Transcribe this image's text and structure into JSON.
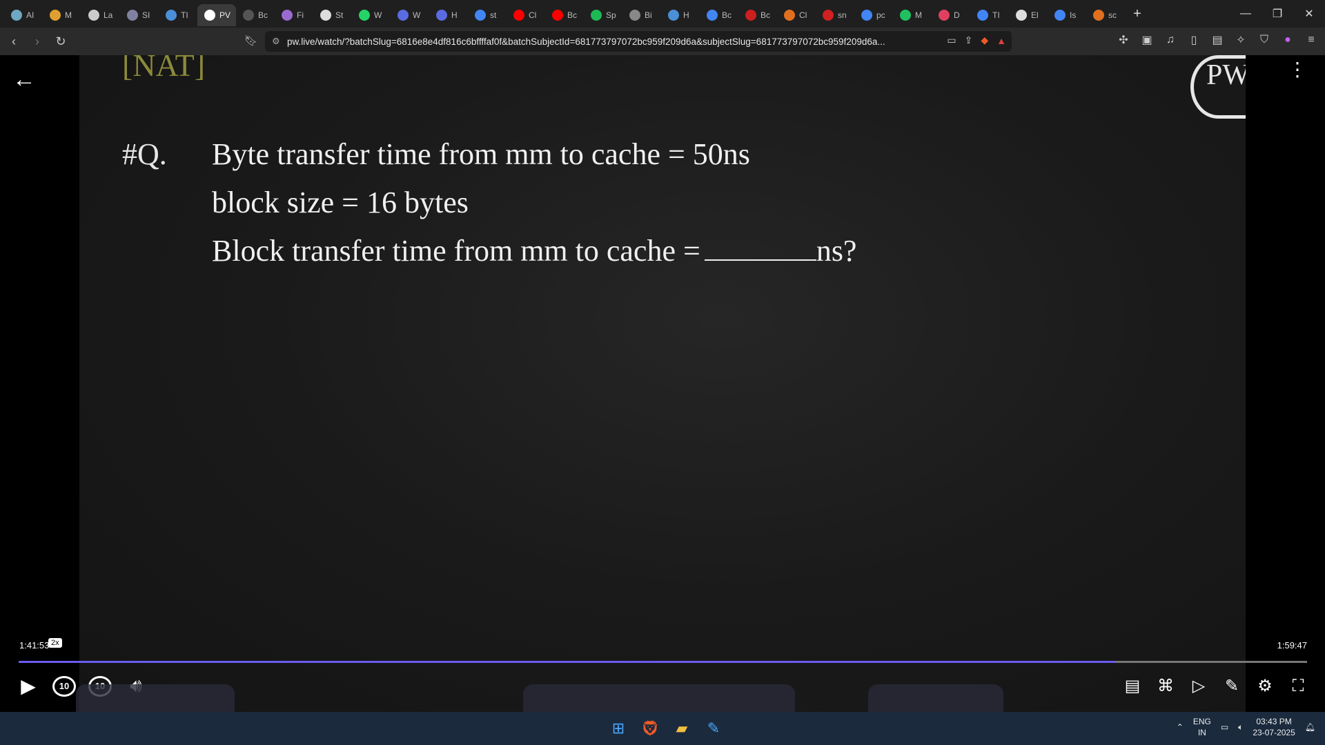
{
  "browser": {
    "tabs": [
      {
        "label": "AI",
        "color": "#6fa8c4"
      },
      {
        "label": "M",
        "color": "#e0a030"
      },
      {
        "label": "La",
        "color": "#cccccc"
      },
      {
        "label": "SI",
        "color": "#8080a0"
      },
      {
        "label": "TI",
        "color": "#4a8fd8"
      },
      {
        "label": "PV",
        "color": "#ffffff",
        "active": true
      },
      {
        "label": "Bc",
        "color": "#555555"
      },
      {
        "label": "Fi",
        "color": "#9a6ad0"
      },
      {
        "label": "St",
        "color": "#dddddd"
      },
      {
        "label": "W",
        "color": "#25d366"
      },
      {
        "label": "W",
        "color": "#5a6ae0"
      },
      {
        "label": "H",
        "color": "#5a6ae0"
      },
      {
        "label": "st",
        "color": "#4285f4"
      },
      {
        "label": "Cl",
        "color": "#ff0000"
      },
      {
        "label": "Bc",
        "color": "#ff0000"
      },
      {
        "label": "Sp",
        "color": "#1db954"
      },
      {
        "label": "Bi",
        "color": "#888888"
      },
      {
        "label": "H",
        "color": "#4a8fd8"
      },
      {
        "label": "Bc",
        "color": "#4285f4"
      },
      {
        "label": "Bc",
        "color": "#cc2020"
      },
      {
        "label": "Cl",
        "color": "#e07020"
      },
      {
        "label": "sn",
        "color": "#d02020"
      },
      {
        "label": "pc",
        "color": "#4285f4"
      },
      {
        "label": "M",
        "color": "#20c060"
      },
      {
        "label": "D",
        "color": "#e04060"
      },
      {
        "label": "TI",
        "color": "#4285f4"
      },
      {
        "label": "El",
        "color": "#dddddd"
      },
      {
        "label": "Is",
        "color": "#4285f4"
      },
      {
        "label": "sc",
        "color": "#e07020"
      }
    ],
    "active_tab_close": "✕",
    "new_tab": "+",
    "window_controls": {
      "minimize": "—",
      "restore": "❐",
      "close": "✕"
    },
    "url": "pw.live/watch/?batchSlug=6816e8e4df816c6bffffaf0f&batchSubjectId=681773797072bc959f209d6a&subjectSlug=681773797072bc959f209d6a..."
  },
  "video": {
    "tag": "[NAT]",
    "question_label": "#Q.",
    "lines": [
      "Byte transfer time from mm to cache = 50ns",
      "block size = 16 bytes",
      "Block transfer time from mm to cache ="
    ],
    "blank_suffix": "ns?",
    "logo": "PW"
  },
  "player": {
    "current_time": "1:41:53",
    "speed": "2x",
    "duration": "1:59:47",
    "progress_fraction": 0.851,
    "skip_back": "10",
    "skip_forward": "10"
  },
  "taskbar": {
    "lang_top": "ENG",
    "lang_bottom": "IN",
    "time": "03:43 PM",
    "date": "23-07-2025"
  }
}
